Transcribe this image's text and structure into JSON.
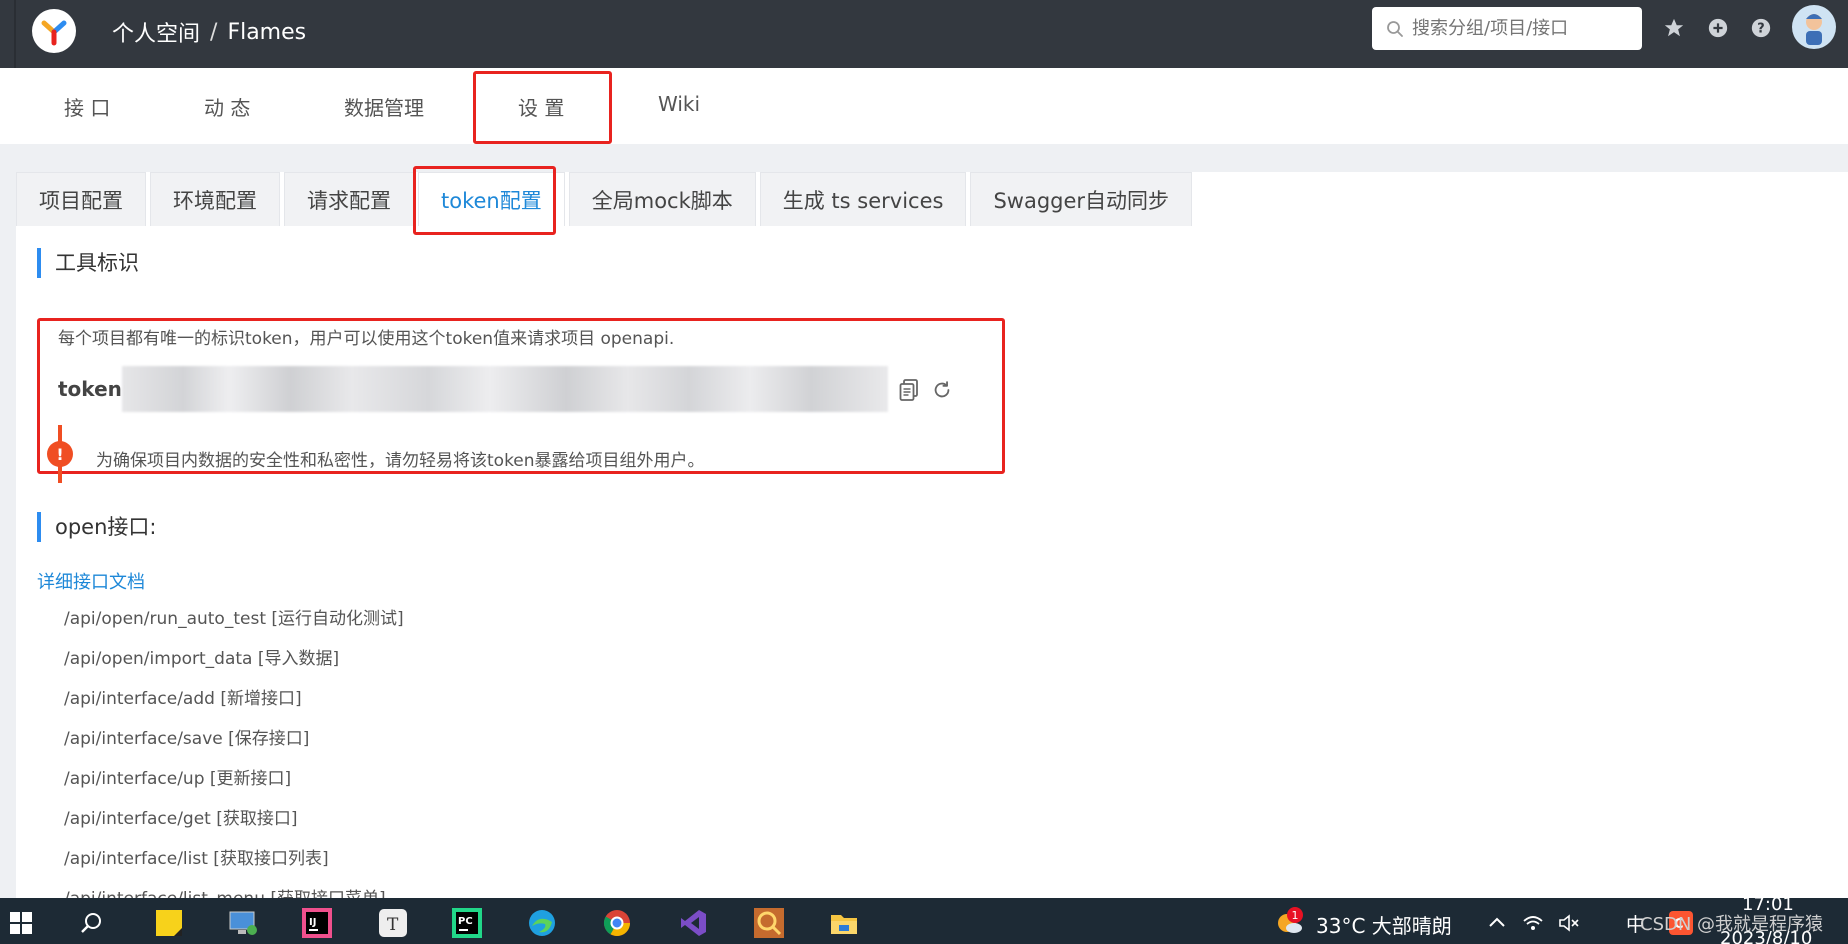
{
  "header": {
    "breadcrumb_home": "个人空间",
    "breadcrumb_sep": "/",
    "breadcrumb_project": "Flames",
    "search_placeholder": "搜索分组/项目/接口"
  },
  "mainnav": {
    "items": [
      "接 口",
      "动 态",
      "数据管理",
      "设 置",
      "Wiki"
    ],
    "active_index": 3
  },
  "subtabs": {
    "items": [
      "项目配置",
      "环境配置",
      "请求配置",
      "token配置",
      "全局mock脚本",
      "生成 ts services",
      "Swagger自动同步"
    ],
    "active_index": 3
  },
  "token_section": {
    "title": "工具标识",
    "description": "每个项目都有唯一的标识token，用户可以使用这个token值来请求项目 openapi.",
    "token_label": "token:",
    "warning_symbol": "!",
    "warning": "为确保项目内数据的安全性和私密性，请勿轻易将该token暴露给项目组外用户。"
  },
  "open_section": {
    "title": "open接口:",
    "doc_link": "详细接口文档",
    "apis": [
      "/api/open/run_auto_test [运行自动化测试]",
      "/api/open/import_data [导入数据]",
      "/api/interface/add [新增接口]",
      "/api/interface/save [保存接口]",
      "/api/interface/up [更新接口]",
      "/api/interface/get [获取接口]",
      "/api/interface/list [获取接口列表]",
      "/api/interface/list_menu [获取接口菜单]"
    ]
  },
  "taskbar": {
    "weather_badge": "1",
    "weather": "33°C  大部晴朗",
    "ime": "中",
    "time": "17:01",
    "date": "2023/8/10",
    "watermark": "CSDN @我就是程序猿"
  },
  "colors": {
    "accent": "#1e88d8",
    "highlight_box": "#e8231f",
    "warning": "#f04e23",
    "header_bg": "#33383f"
  }
}
